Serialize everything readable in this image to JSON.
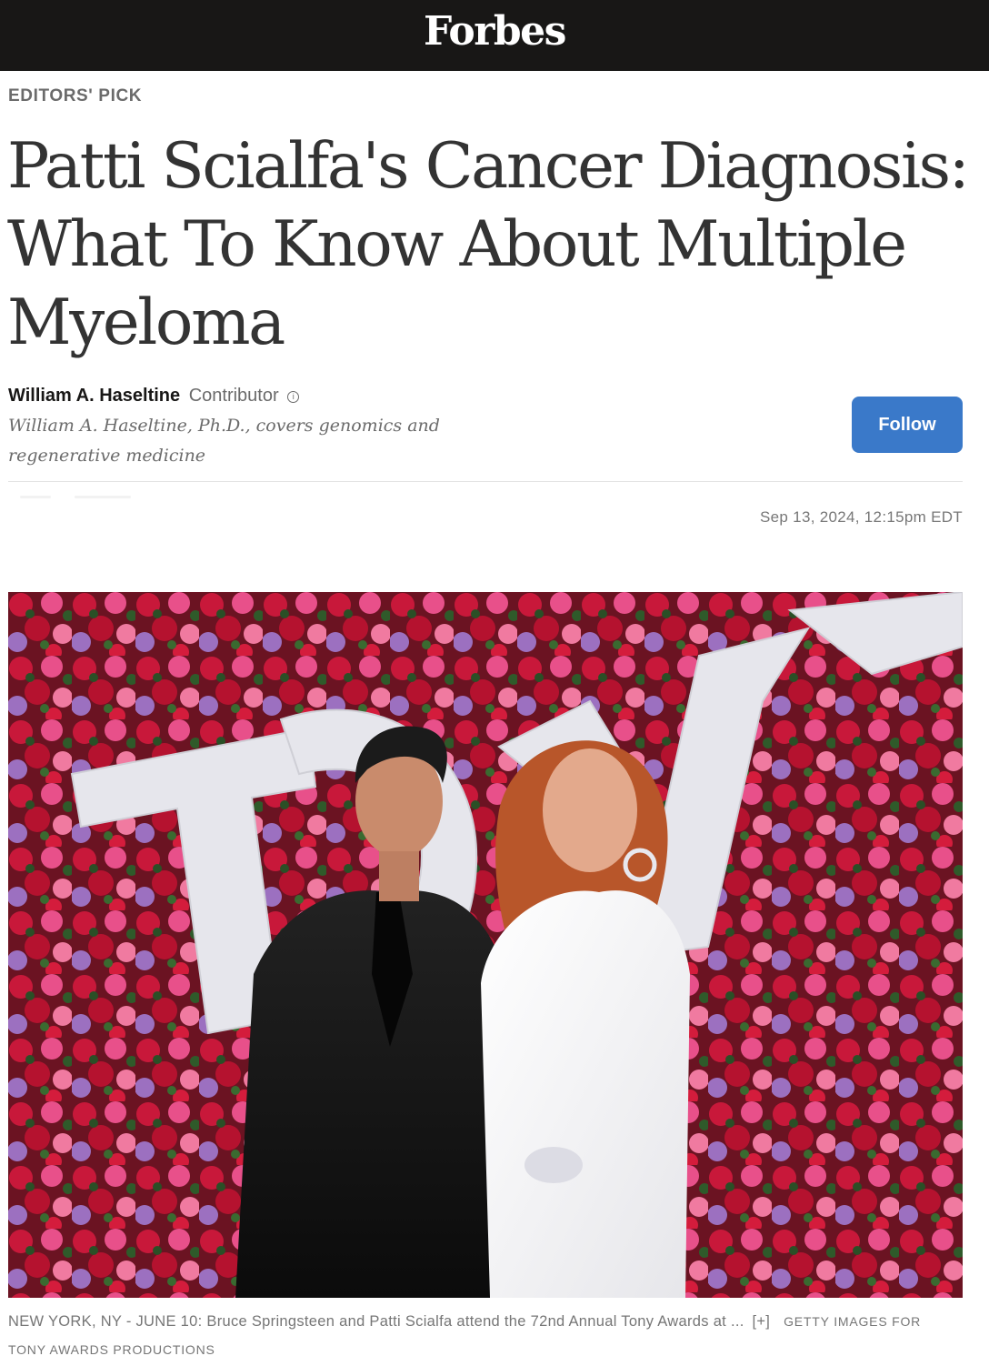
{
  "header": {
    "logo": "Forbes"
  },
  "article": {
    "eyebrow": "EDITORS' PICK",
    "headline_lines": [
      "Patti Scialfa's Cancer Diagnosis:",
      "What To Know About Multiple",
      "Myeloma"
    ],
    "author": {
      "name": "William A. Haseltine",
      "role": "Contributor",
      "info_icon": "info-icon",
      "bio_lines": [
        "William A. Haseltine, Ph.D., covers genomics and",
        "regenerative medicine"
      ]
    },
    "follow_label": "Follow",
    "timestamp": "Sep 13, 2024, 12:15pm EDT"
  },
  "image": {
    "sign_text": "TONY",
    "caption": "NEW YORK, NY - JUNE 10: Bruce Springsteen and Patti Scialfa attend the 72nd Annual Tony Awards at ...",
    "caption_expand": "[+]",
    "credit": "GETTY IMAGES FOR TONY AWARDS PRODUCTIONS"
  },
  "colors": {
    "topbar": "#181716",
    "follow_button": "#3a79c9",
    "muted_text": "#6b6b6b"
  }
}
